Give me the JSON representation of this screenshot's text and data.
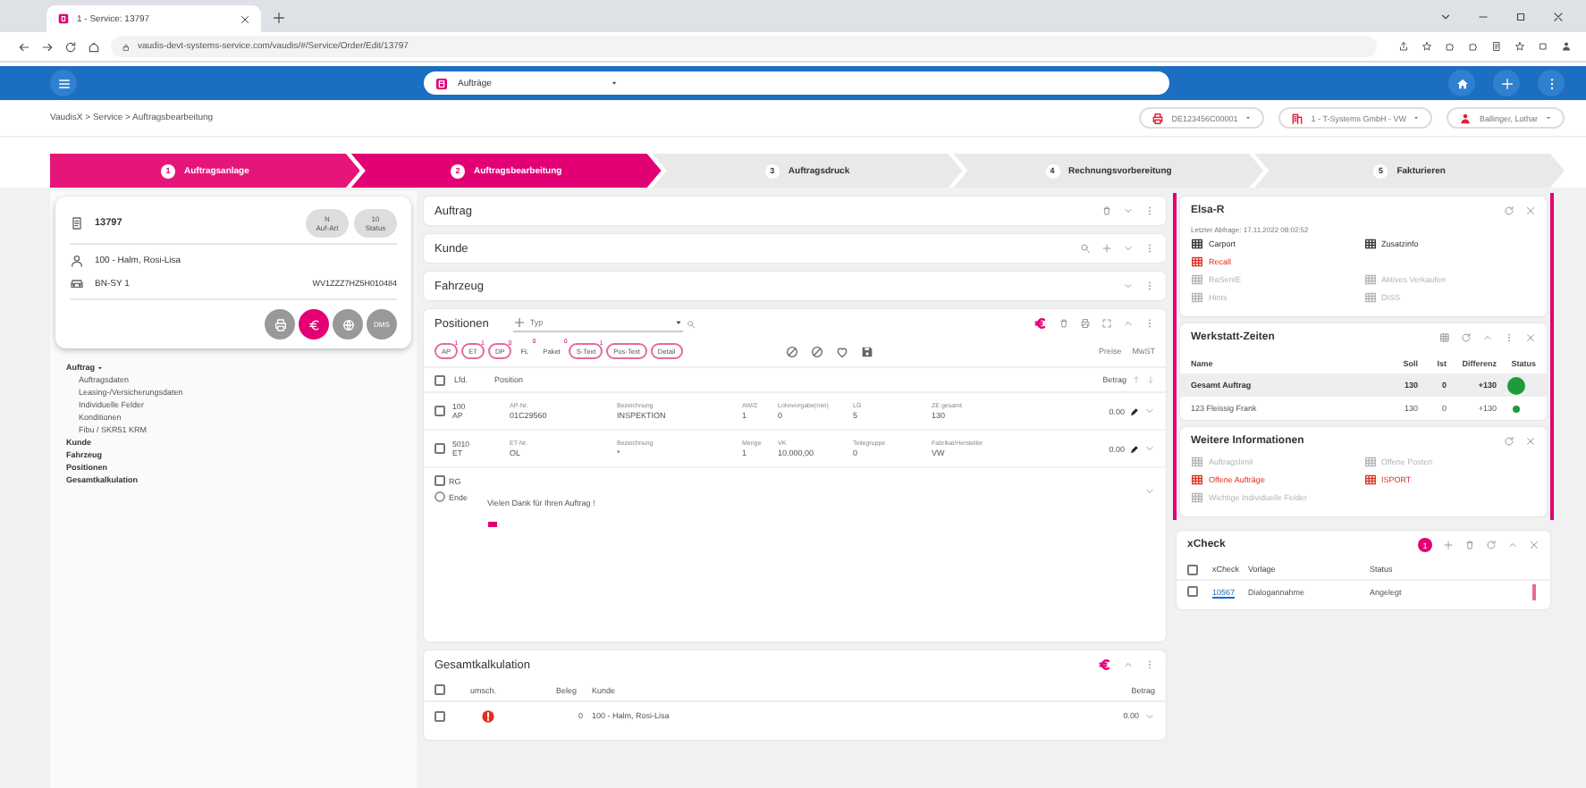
{
  "browser": {
    "tab_title": "1 - Service: 13797",
    "url": "vaudis-devt-systems-service.com/vaudis/#/Service/Order/Edit/13797"
  },
  "app_bar": {
    "module": "Aufträge"
  },
  "breadcrumb": "VaudisX > Service > Auftragsbearbeitung",
  "context": [
    {
      "kind": "printer",
      "label": "DE123456C00001"
    },
    {
      "kind": "company",
      "label": "1 - T-Systems GmbH - VW"
    },
    {
      "kind": "user",
      "label": "Ballinger, Lothar"
    }
  ],
  "steps": [
    {
      "number": "1",
      "label": "Auftragsanlage",
      "completed": true,
      "selected": false
    },
    {
      "number": "2",
      "label": "Auftragsbearbeitung",
      "completed": false,
      "selected": true
    },
    {
      "number": "3",
      "label": "Auftragsdruck",
      "completed": false,
      "selected": false
    },
    {
      "number": "4",
      "label": "Rechnungsvorbereitung",
      "completed": false,
      "selected": false
    },
    {
      "number": "5",
      "label": "Fakturieren",
      "completed": false,
      "selected": false
    }
  ],
  "order_card": {
    "number": "13797",
    "chips": [
      {
        "value": "N",
        "label": "Auf-Art"
      },
      {
        "value": "10",
        "label": "Status"
      }
    ],
    "customer": "100 - Halm, Rosi-Lisa",
    "plate": "BN-SY 1",
    "vin": "WV1ZZZ7HZ5H010484",
    "actions": [
      {
        "kind": "print",
        "active": false
      },
      {
        "kind": "euro",
        "active": true
      },
      {
        "kind": "globe",
        "active": false
      },
      {
        "kind": "text",
        "label": "DMS",
        "active": false
      }
    ]
  },
  "nav": [
    {
      "label": "Auftrag",
      "expanded": true,
      "children": [
        {
          "label": "Auftragsdaten"
        },
        {
          "label": "Leasing-/Versicherungsdaten"
        },
        {
          "label": "Individuelle Felder"
        },
        {
          "label": "Konditionen"
        },
        {
          "label": "Fibu / SKR51 KRM"
        }
      ]
    },
    {
      "label": "Kunde"
    },
    {
      "label": "Fahrzeug"
    },
    {
      "label": "Positionen"
    },
    {
      "label": "Gesamtkalkulation"
    }
  ],
  "sections": [
    {
      "kind": "order",
      "title": "Auftrag"
    },
    {
      "kind": "customer",
      "title": "Kunde"
    },
    {
      "kind": "vehicle",
      "title": "Fahrzeug"
    }
  ],
  "positions": {
    "title": "Positionen",
    "add_label": "Typ",
    "filters": [
      {
        "label": "AP",
        "count": "1",
        "outlined": true
      },
      {
        "label": "ET",
        "count": "1",
        "outlined": true
      },
      {
        "label": "DP",
        "count": "0",
        "outlined": true
      },
      {
        "label": "FL",
        "count": "0",
        "outlined": false
      },
      {
        "label": "Paket",
        "count": "0",
        "outlined": false
      },
      {
        "label": "S-Text",
        "count": "1",
        "outlined": true
      },
      {
        "label": "Pos-Text",
        "outlined": true
      },
      {
        "label": "Detail",
        "outlined": true
      }
    ],
    "toggles": [
      "Preise",
      "MwST"
    ],
    "header_checked": false,
    "columns": [
      "Lfd.",
      "Position",
      "Betrag"
    ],
    "rows": [
      {
        "kind": "item",
        "checked": false,
        "number": "100",
        "type": "AP",
        "amount": "0.00",
        "fields": [
          {
            "label": "AP-Nr.",
            "value": "01C29560"
          },
          {
            "label": "Bezeichnung",
            "value": "INSPEKTION"
          },
          {
            "label": "AW/Z",
            "value": "1"
          },
          {
            "label": "Lohnvorgabe(min)",
            "value": "0"
          },
          {
            "label": "LG",
            "value": "5"
          },
          {
            "label": "ZE gesamt",
            "value": "130"
          }
        ]
      },
      {
        "kind": "item",
        "checked": false,
        "number": "5010",
        "type": "ET",
        "amount": "0.00",
        "fields": [
          {
            "label": "ET-Nr.",
            "value": "OL"
          },
          {
            "label": "Bezeichnung",
            "value": "*"
          },
          {
            "label": "Menge",
            "value": "1"
          },
          {
            "label": "VK",
            "value": "10.000,00"
          },
          {
            "label": "Teilegruppe",
            "value": "0"
          },
          {
            "label": "Fabrikat/Hersteller",
            "value": "VW"
          }
        ]
      },
      {
        "kind": "text",
        "checked": false,
        "rg_label": "RG",
        "end_label": "Ende",
        "end_selected": false,
        "text": "Vielen Dank für Ihren Auftrag !"
      }
    ]
  },
  "totals": {
    "title": "Gesamtkalkulation",
    "header_checked": false,
    "columns": [
      "umsch.",
      "Beleg",
      "Kunde",
      "Betrag"
    ],
    "rows": [
      {
        "checked": false,
        "warning": true,
        "beleg": "0",
        "customer": "100 - Halm, Rosi-Lisa",
        "amount": "0.00"
      }
    ]
  },
  "elsa": {
    "title": "Elsa-R",
    "last_query": "Letzter Abfrage: 17.11.2022 08:02:52",
    "rows": [
      [
        {
          "label": "Carport",
          "alert": false,
          "disabled": false
        },
        {
          "label": "Zusatzinfo",
          "alert": false,
          "disabled": false
        }
      ],
      [
        {
          "label": "Recall",
          "alert": true,
          "disabled": false
        }
      ],
      [
        {
          "label": "RaSenIE",
          "alert": false,
          "disabled": true
        },
        {
          "label": "Aktives Verkaufen",
          "alert": false,
          "disabled": true
        }
      ],
      [
        {
          "label": "Hints",
          "alert": false,
          "disabled": true
        },
        {
          "label": "DISS",
          "alert": false,
          "disabled": true
        }
      ]
    ]
  },
  "workshop": {
    "title": "Werkstatt-Zeiten",
    "columns": [
      "Name",
      "Soll",
      "Ist",
      "Differenz",
      "Status"
    ],
    "rows": [
      {
        "kind": "total",
        "selected": true,
        "name": "Gesamt Auftrag",
        "target": "130",
        "actual": "0",
        "diff": "+130",
        "color": "#1e9b3c"
      },
      {
        "kind": "person",
        "selected": false,
        "name": "123 Fleissig Frank",
        "target": "130",
        "actual": "0",
        "diff": "+130",
        "color": "#1e9b3c"
      }
    ]
  },
  "more_info": {
    "title": "Weitere Informationen",
    "rows": [
      [
        {
          "label": "Auftragslimit",
          "alert": false,
          "disabled": true
        },
        {
          "label": "Offene Posten",
          "alert": false,
          "disabled": true
        }
      ],
      [
        {
          "label": "Offene Aufträge",
          "alert": true,
          "disabled": false
        },
        {
          "label": "ISPORT",
          "alert": true,
          "disabled": false
        }
      ],
      [
        {
          "label": "Wichtige Individuelle Felder",
          "alert": false,
          "disabled": true
        }
      ]
    ]
  },
  "xcheck": {
    "title": "xCheck",
    "badge": "1",
    "header_checked": false,
    "columns": [
      "xCheck",
      "Vorlage",
      "Status"
    ],
    "rows": [
      {
        "checked": false,
        "id": "10567",
        "template": "Dialogannahme",
        "status": "Angelegt"
      }
    ]
  }
}
